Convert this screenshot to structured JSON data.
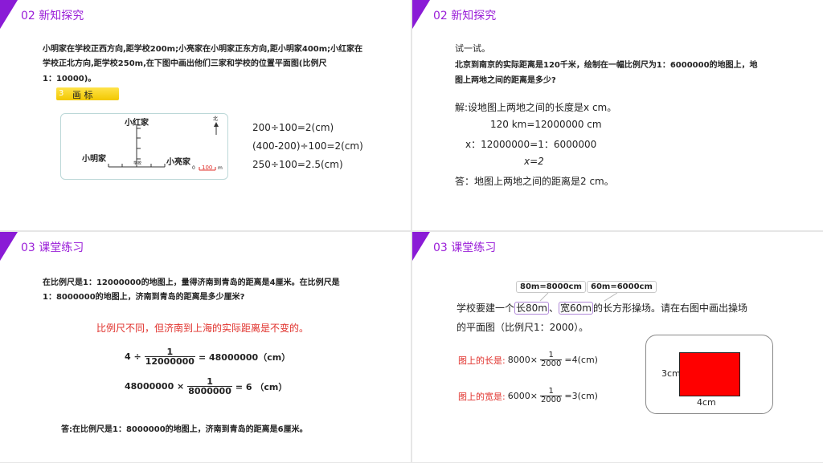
{
  "slide1": {
    "section": "02  新知探究",
    "problem_lines": [
      "小明家在学校正西方向,距学校200m;小亮家在小明家正东方向,距小明家400m;小红家在",
      "学校正北方向,距学校250m,在下图中画出他们三家和学校的位置平面图(比例尺",
      "1：10000)。"
    ],
    "step_number": "3",
    "step_label": "画 标",
    "map": {
      "xiaohong": "小红家",
      "xiaoming": "小明家",
      "xiaoliang": "小亮家",
      "school": "学校",
      "north": "北",
      "scale_label": "100",
      "scale_unit": "m",
      "scale_zero": "0"
    },
    "calc_lines": [
      "200÷100=2(cm)",
      "(400-200)÷100=2(cm)",
      "250÷100=2.5(cm)"
    ]
  },
  "slide2": {
    "section": "02  新知探究",
    "try_label": "试一试。",
    "problem_lines": [
      "北京到南京的实际距离是120千米，绘制在一幅比例尺为1：6000000的地图上，地",
      "图上两地之间的距离是多少?"
    ],
    "solution_lines": [
      "解:设地图上两地之间的长度是x cm。",
      "120 km=12000000  cm",
      "x：12000000=1：6000000",
      "x=2",
      "答：地图上两地之间的距离是2 cm。"
    ]
  },
  "slide3": {
    "section": "03  课堂练习",
    "problem_lines": [
      "在比例尺是1：12000000的地图上，量得济南到青岛的距离是4厘米。在比例尺是",
      "1：8000000的地图上，济南到青岛的距离是多少厘米?"
    ],
    "note": "比例尺不同，但济南到上海的实际距离是不变的。",
    "eq1": {
      "lhs": "4 ÷",
      "num": "1",
      "den": "12000000",
      "rhs": "= 48000000（cm）"
    },
    "eq2": {
      "lhs": "48000000 ×",
      "num": "1",
      "den": "8000000",
      "rhs": "= 6 （cm）"
    },
    "answer": "答:在比例尺是1：8000000的地图上，济南到青岛的距离是6厘米。"
  },
  "slide4": {
    "section": "03  课堂练习",
    "tag1": "80m=8000cm",
    "tag2": "60m=6000cm",
    "problem": {
      "a": "学校要建一个",
      "h1": "长80m",
      "b": "、",
      "h2": "宽60m",
      "c": "的长方形操场。请在右图中画出操场",
      "line2": "的平面图（比例尺1：2000）。"
    },
    "length": {
      "label": "图上的长是:",
      "lhs": "8000×",
      "num": "1",
      "den": "2000",
      "rhs": "=4(cm)"
    },
    "width": {
      "label": "图上的宽是:",
      "lhs": "6000×",
      "num": "1",
      "den": "2000",
      "rhs": "=3(cm)"
    },
    "rect_h_label": "3cm",
    "rect_w_label": "4cm",
    "rect_color": "#ff0000"
  },
  "colors": {
    "accent": "#8a1bd6",
    "section_text": "#9a1ed8",
    "red_text": "#e0302b",
    "step_badge": "#f2c800"
  }
}
